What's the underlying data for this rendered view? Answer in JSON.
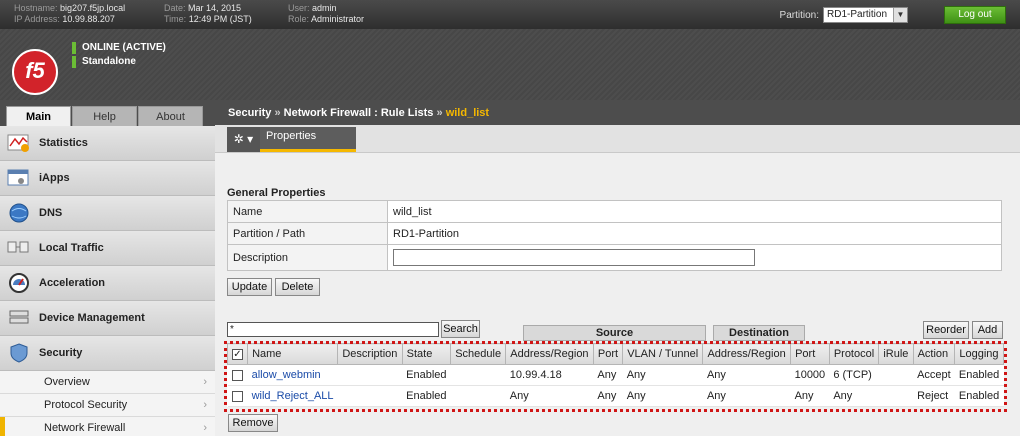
{
  "topbar": {
    "hostname_label": "Hostname:",
    "hostname": "big207.f5jp.local",
    "ip_label": "IP Address:",
    "ip": "10.99.88.207",
    "date_label": "Date:",
    "date": "Mar 14, 2015",
    "time_label": "Time:",
    "time": "12:49 PM (JST)",
    "user_label": "User:",
    "user": "admin",
    "role_label": "Role:",
    "role": "Administrator",
    "partition_label": "Partition:",
    "partition_value": "RD1-Partition",
    "logout_label": "Log out"
  },
  "header": {
    "logo_text": "f5",
    "status_line1": "ONLINE (ACTIVE)",
    "status_line2": "Standalone"
  },
  "leftnav": {
    "tabs": [
      {
        "label": "Main"
      },
      {
        "label": "Help"
      },
      {
        "label": "About"
      }
    ],
    "items": [
      {
        "label": "Statistics",
        "icon": "statistics-icon"
      },
      {
        "label": "iApps",
        "icon": "iapps-icon"
      },
      {
        "label": "DNS",
        "icon": "dns-icon"
      },
      {
        "label": "Local Traffic",
        "icon": "local-traffic-icon"
      },
      {
        "label": "Acceleration",
        "icon": "acceleration-icon"
      },
      {
        "label": "Device Management",
        "icon": "device-management-icon"
      },
      {
        "label": "Security",
        "icon": "security-shield-icon"
      }
    ],
    "subitems": [
      {
        "label": "Overview"
      },
      {
        "label": "Protocol Security"
      },
      {
        "label": "Network Firewall"
      }
    ]
  },
  "breadcrumb": {
    "part1": "Security",
    "sep": "»",
    "part2": "Network Firewall : Rule Lists",
    "current": "wild_list"
  },
  "subtabs": {
    "gear_icon": "gear-icon",
    "properties_label": "Properties"
  },
  "general": {
    "title": "General Properties",
    "rows": [
      {
        "label": "Name",
        "value": "wild_list"
      },
      {
        "label": "Partition / Path",
        "value": "RD1-Partition"
      },
      {
        "label": "Description",
        "value": ""
      }
    ],
    "update_label": "Update",
    "delete_label": "Delete"
  },
  "rules": {
    "search_value": "*",
    "search_label": "Search",
    "source_group": "Source",
    "destination_group": "Destination",
    "reorder_label": "Reorder",
    "add_label": "Add",
    "remove_label": "Remove",
    "columns": [
      "Name",
      "Description",
      "State",
      "Schedule",
      "Address/Region",
      "Port",
      "VLAN / Tunnel",
      "Address/Region",
      "Port",
      "Protocol",
      "iRule",
      "Action",
      "Logging"
    ],
    "rows": [
      {
        "name": "allow_webmin",
        "description": "",
        "state": "Enabled",
        "schedule": "",
        "src_addr": "10.99.4.18",
        "src_port": "Any",
        "vlan": "Any",
        "dst_addr": "Any",
        "dst_port": "10000",
        "protocol": "6 (TCP)",
        "irule": "",
        "action": "Accept",
        "logging": "Enabled"
      },
      {
        "name": "wild_Reject_ALL",
        "description": "",
        "state": "Enabled",
        "schedule": "",
        "src_addr": "Any",
        "src_port": "Any",
        "vlan": "Any",
        "dst_addr": "Any",
        "dst_port": "Any",
        "protocol": "Any",
        "irule": "",
        "action": "Reject",
        "logging": "Enabled"
      }
    ]
  }
}
